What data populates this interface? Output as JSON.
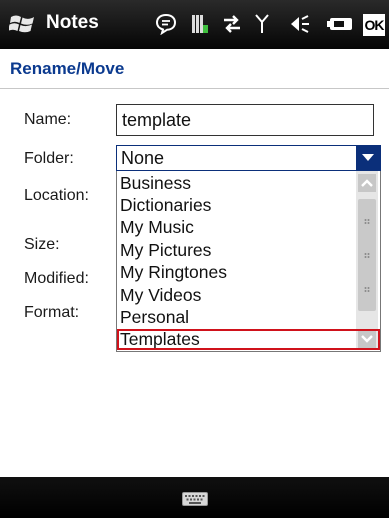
{
  "titlebar": {
    "app_title": "Notes",
    "ok_label": "OK"
  },
  "header": {
    "title": "Rename/Move"
  },
  "form": {
    "name_label": "Name:",
    "name_value": "template",
    "folder_label": "Folder:",
    "folder_value": "None",
    "location_label": "Location:",
    "size_label": "Size:",
    "modified_label": "Modified:",
    "format_label": "Format:"
  },
  "dropdown": {
    "options": [
      "Business",
      "Dictionaries",
      "My Music",
      "My Pictures",
      "My Ringtones",
      "My Videos",
      "Personal",
      "Templates"
    ],
    "highlighted": "Templates"
  },
  "colors": {
    "header_text": "#0b3a8f",
    "select_accent": "#0b2f7a",
    "highlight_border": "#d0121b"
  },
  "icons": [
    "windows-start-icon",
    "speech-bubble-icon",
    "signal-bars-icon",
    "data-arrows-icon",
    "antenna-icon",
    "speaker-icon",
    "battery-icon",
    "keyboard-icon",
    "chevron-up-icon",
    "chevron-down-icon"
  ]
}
